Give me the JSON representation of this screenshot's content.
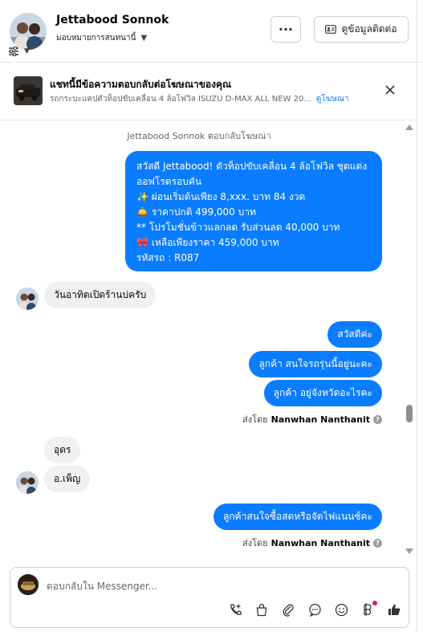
{
  "header": {
    "name": "Jettabood Sonnok",
    "assignee": "มอบหมายการสนทนานี้",
    "contact_label": "ดูข้อมูลติดต่อ"
  },
  "ad": {
    "title": "แชทนี้มีข้อความตอบกลับต่อโฆษณาของคุณ",
    "description": "รถกระบะแคปตัวท็อปขับเคลื่อน 4 ล้อโฟวิล ISUZU D-MAX ALL NEW 20...",
    "view_link": "ดูโฆษณา"
  },
  "chat": {
    "system_note": "Jettabood Sonnok ตอบกลับโฆษณา",
    "ad_message": "สวัสดี Jettabood! ตัวท็อปขับเคลื่อน 4 ล้อโฟวิล ชุดแต่งออฟโรดรอบคัน\n✨  ผ่อนเริ่มต้นเพียง 8,xxx. บาท 84 งวด\n🛎️ ราคาปกติ 499,000 บาท\n** โปรโมชั่นข้าวแลกลด รับส่วนลด 40,000 บาท\n🎀  เหลือเพียงราคา 459,000 บาท\n รหัสรถ : R087",
    "in_1": "วันอาทิตเปิดร้านบ่ครับ",
    "out_1": "สวัสดีค่ะ",
    "out_2": "ลูกค้า สนใจรถรุ่นนี้อยู่นะคะ",
    "out_3": "ลูกค้า  อยู่จังหวัดอะไรคะ",
    "sent_by_label": "ส่งโดย",
    "sent_by_name": "Nanwhan Nanthanit",
    "in_2": "อุดร",
    "in_3": "อ.เพ็ญ",
    "out_4": "ลูกค้าสนใจซื้อสดหรือจัดไฟแนนซ์คะ"
  },
  "composer": {
    "placeholder": "ตอบกลับใน Messenger..."
  },
  "colors": {
    "accent": "#0a7cff",
    "incoming": "#f0f0f0",
    "link": "#1877f2"
  }
}
